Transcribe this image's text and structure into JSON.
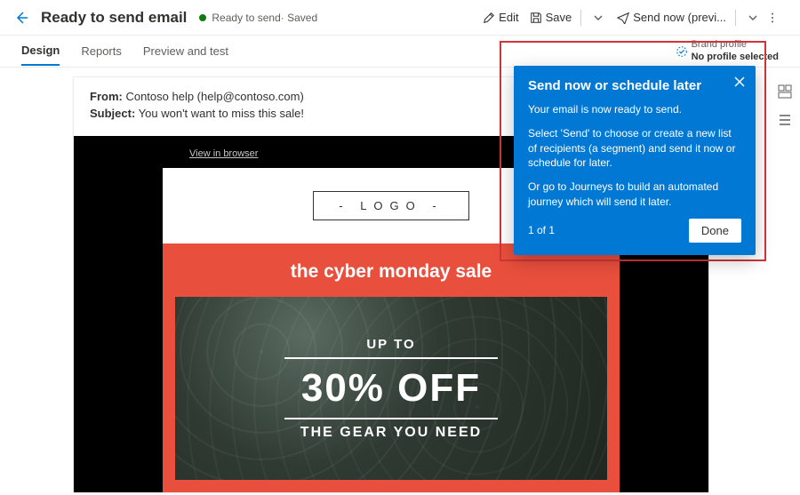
{
  "header": {
    "page_title": "Ready to send email",
    "status_label": "Ready to send",
    "status_suffix": " · Saved",
    "edit_label": "Edit",
    "save_label": "Save",
    "send_label": "Send now (previ..."
  },
  "tabs": {
    "design": "Design",
    "reports": "Reports",
    "preview": "Preview and test"
  },
  "brand_profile": {
    "label": "Brand profile",
    "value": "No profile selected"
  },
  "email_meta": {
    "from_label": "From:",
    "from_value": " Contoso help (help@contoso.com)",
    "subject_label": "Subject:",
    "subject_value": " You won't want to miss this sale!"
  },
  "email_body": {
    "view_in_browser": "View in browser",
    "logo_text": "- LOGO -",
    "sale_title": "the cyber monday sale",
    "hero_line1": "UP TO",
    "hero_line2": "30% OFF",
    "hero_line3": "THE GEAR YOU NEED"
  },
  "callout": {
    "title": "Send now or schedule later",
    "p1": "Your email is now ready to send.",
    "p2": "Select 'Send' to choose or create a new list of recipients (a segment) and send it now or schedule for later.",
    "p3": "Or go to Journeys to build an automated journey which will send it later.",
    "step": "1 of 1",
    "done": "Done"
  }
}
